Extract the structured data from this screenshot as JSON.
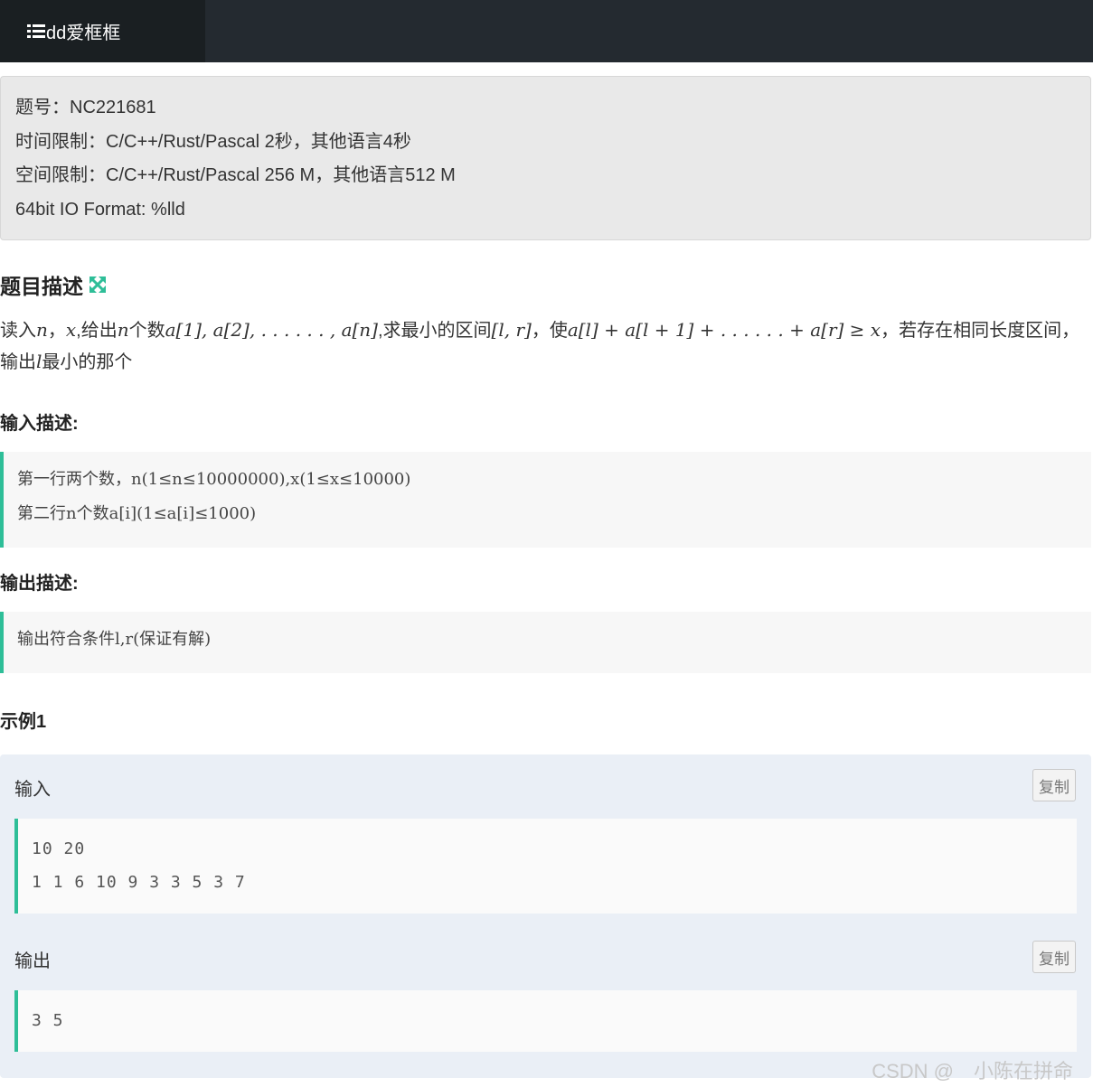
{
  "nav": {
    "brand": "dd爱框框"
  },
  "info": {
    "lines": [
      "题号：NC221681",
      "时间限制：C/C++/Rust/Pascal 2秒，其他语言4秒",
      "空间限制：C/C++/Rust/Pascal 256 M，其他语言512 M",
      "64bit IO Format: %lld"
    ]
  },
  "problem": {
    "title": "题目描述",
    "desc": {
      "t1": "读入",
      "n": "n",
      "t2": "，",
      "x": "x",
      "t3": ",给出",
      "t4": "个数",
      "seq": "a[1], a[2], . . . . . . , a[n]",
      "t5": ",求最小的区间",
      "interval": "[l, r]",
      "t6": "，使",
      "ineq": "a[l] + a[l + 1] + . . . . . . + a[r] ≥ x",
      "t7": "，若存在相同长度区间，输出",
      "l": "l",
      "t8": "最小的那个"
    }
  },
  "input_desc": {
    "title": "输入描述:",
    "lines": [
      "第一行两个数，n(1≤n≤10000000),x(1≤x≤10000)",
      "第二行n个数a[i](1≤a[i]≤1000)"
    ]
  },
  "output_desc": {
    "title": "输出描述:",
    "lines": [
      "输出符合条件l,r(保证有解)"
    ]
  },
  "example": {
    "title": "示例1",
    "input_label": "输入",
    "output_label": "输出",
    "copy_label": "复制",
    "input_lines": [
      "10 20",
      "1 1 6 10 9 3 3 5 3 7"
    ],
    "output_lines": [
      "3 5"
    ]
  },
  "watermark": "CSDN @　小陈在拼命",
  "colors": {
    "accent": "#2ebe98",
    "nav_bg": "#242a30",
    "brand_bg": "#1a1f22"
  }
}
